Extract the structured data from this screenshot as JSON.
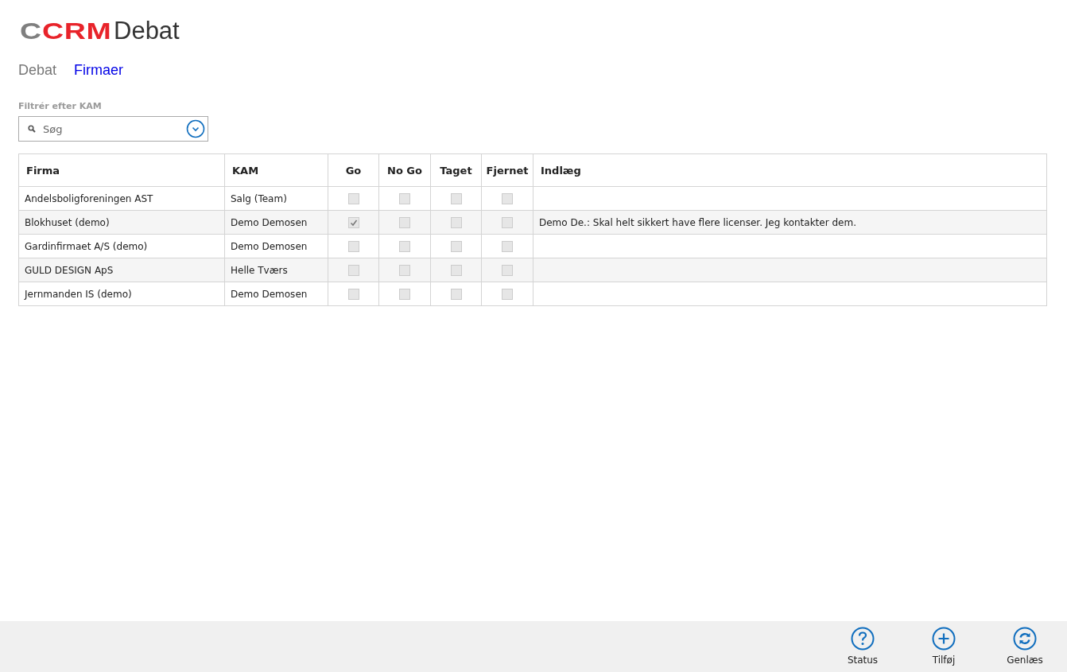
{
  "logo": {
    "mark_grey": "C",
    "mark_red": "CRM",
    "title": "Debat"
  },
  "nav": [
    {
      "label": "Debat",
      "selected": false
    },
    {
      "label": "Firmaer",
      "selected": true
    }
  ],
  "filter": {
    "label": "Filtrér efter KAM",
    "placeholder": "Søg"
  },
  "table": {
    "columns": [
      {
        "label": "Firma",
        "kind": "text"
      },
      {
        "label": "KAM",
        "kind": "text"
      },
      {
        "label": "Go",
        "kind": "check"
      },
      {
        "label": "No Go",
        "kind": "check"
      },
      {
        "label": "Taget",
        "kind": "check"
      },
      {
        "label": "Fjernet",
        "kind": "check"
      },
      {
        "label": "Indlæg",
        "kind": "text"
      }
    ],
    "rows": [
      {
        "firma": "Andelsboligforeningen AST",
        "kam": "Salg (Team)",
        "go": false,
        "no_go": false,
        "taget": false,
        "fjernet": false,
        "indlaeg": ""
      },
      {
        "firma": "Blokhuset (demo)",
        "kam": "Demo Demosen",
        "go": true,
        "no_go": false,
        "taget": false,
        "fjernet": false,
        "indlaeg": "Demo De.: Skal helt sikkert have flere licenser. Jeg kontakter dem."
      },
      {
        "firma": "Gardinfirmaet A/S (demo)",
        "kam": "Demo Demosen",
        "go": false,
        "no_go": false,
        "taget": false,
        "fjernet": false,
        "indlaeg": ""
      },
      {
        "firma": "GULD DESIGN ApS",
        "kam": "Helle Tværs",
        "go": false,
        "no_go": false,
        "taget": false,
        "fjernet": false,
        "indlaeg": ""
      },
      {
        "firma": "Jernmanden IS (demo)",
        "kam": "Demo Demosen",
        "go": false,
        "no_go": false,
        "taget": false,
        "fjernet": false,
        "indlaeg": ""
      }
    ]
  },
  "command_bar": [
    {
      "label": "Status",
      "kind": "help"
    },
    {
      "label": "Tilføj",
      "kind": "add"
    },
    {
      "label": "Genlæs",
      "kind": "refresh"
    }
  ]
}
